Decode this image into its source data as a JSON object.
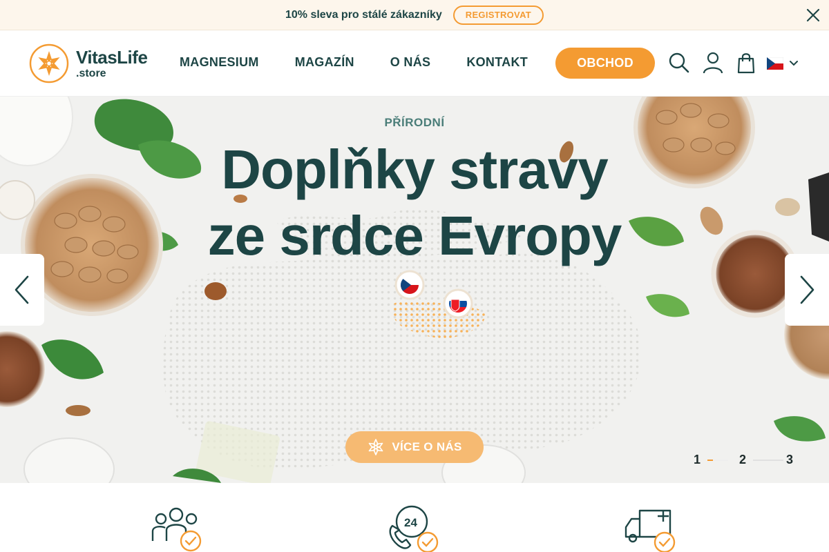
{
  "promo": {
    "text": "10% sleva pro stálé zákazníky",
    "button": "REGISTROVAT",
    "close_icon": "close-icon"
  },
  "header": {
    "logo_name": "VitasLife",
    "logo_sub": ".store",
    "nav": [
      "MAGNESIUM",
      "MAGAZÍN",
      "O NÁS",
      "KONTAKT"
    ],
    "shop_button": "OBCHOD",
    "icons": [
      "search-icon",
      "user-icon",
      "bag-icon",
      "czech-flag-icon",
      "chevron-down-icon"
    ]
  },
  "hero": {
    "eyebrow": "PŘÍRODNÍ",
    "title_line1": "Doplňky stravy",
    "title_line2": "ze srdce Evropy",
    "cta": "VÍCE O NÁS",
    "slides": [
      "1",
      "2",
      "3"
    ],
    "active_slide": 1
  },
  "features": {
    "icons": [
      "people-check-icon",
      "phone-24-check-icon",
      "truck-check-icon"
    ],
    "badge_24": "24"
  },
  "colors": {
    "accent": "#f49b32",
    "accent_light": "#f6ba72",
    "primary": "#1d4545",
    "eyebrow": "#4a7d78",
    "promo_bg": "#fdf6ec"
  }
}
